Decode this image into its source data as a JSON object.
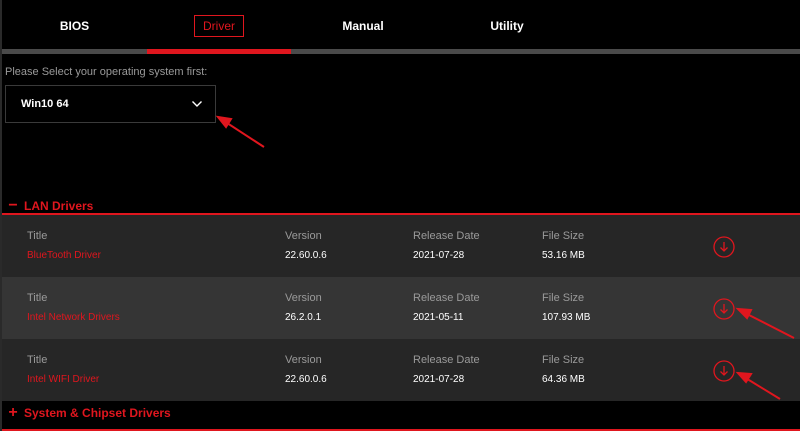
{
  "tabs": [
    {
      "label": "BIOS"
    },
    {
      "label": "Driver"
    },
    {
      "label": "Manual"
    },
    {
      "label": "Utility"
    }
  ],
  "os": {
    "prompt": "Please Select your operating system first:",
    "selected": "Win10 64"
  },
  "sections": {
    "lan": {
      "sign": "−",
      "label": "LAN Drivers"
    },
    "chipset": {
      "sign": "+",
      "label": "System & Chipset Drivers"
    }
  },
  "columns": {
    "title": "Title",
    "version": "Version",
    "release_date": "Release Date",
    "file_size": "File Size"
  },
  "drivers": [
    {
      "title": "BlueTooth Driver",
      "version": "22.60.0.6",
      "release_date": "2021-07-28",
      "file_size": "53.16 MB"
    },
    {
      "title": "Intel Network Drivers",
      "version": "26.2.0.1",
      "release_date": "2021-05-11",
      "file_size": "107.93 MB"
    },
    {
      "title": "Intel WIFI Driver",
      "version": "22.60.0.6",
      "release_date": "2021-07-28",
      "file_size": "64.36 MB"
    }
  ],
  "colors": {
    "accent": "#e0161e",
    "background": "#000000",
    "row_dark": "#262626",
    "row_light": "#353535"
  },
  "icons": {
    "select": "chevron-down-icon",
    "download": "download-circle-icon"
  }
}
